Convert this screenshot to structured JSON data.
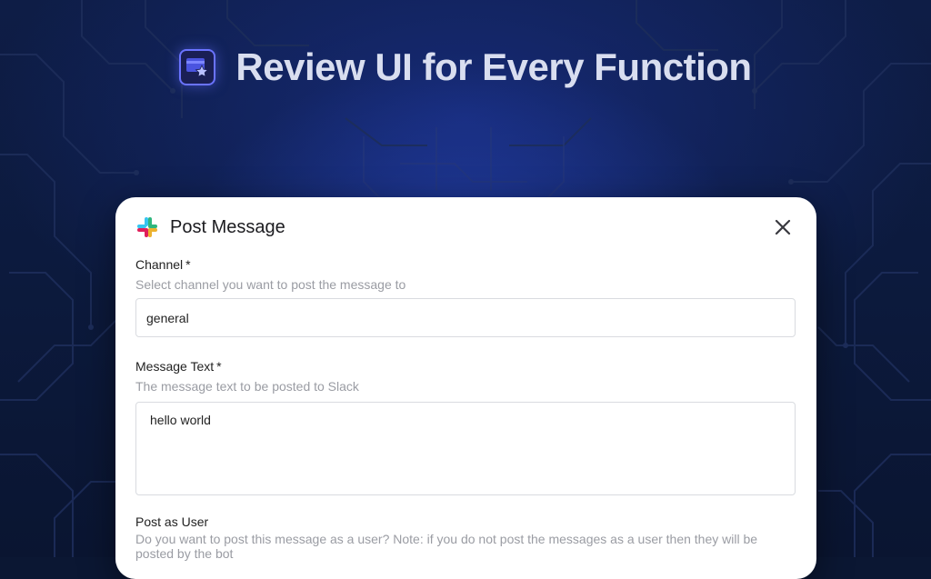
{
  "header": {
    "title": "Review UI for Every Function",
    "logo_icon": "review-card-star-icon"
  },
  "dialog": {
    "title": "Post Message",
    "app_icon": "slack-icon",
    "close_icon": "close-icon",
    "fields": [
      {
        "label": "Channel",
        "required_mark": "*",
        "help": "Select channel you want to post the message to",
        "value": "general"
      },
      {
        "label": "Message Text",
        "required_mark": "*",
        "help": "The message text to be posted to Slack",
        "value": "hello world"
      },
      {
        "label": "Post as User",
        "help": "Do you want to post this message as a user? Note: if you do not post the messages as a user then they will be posted by the bot"
      }
    ]
  },
  "colors": {
    "background": "#0b1733",
    "accent": "#6a73ff",
    "card": "#ffffff"
  }
}
